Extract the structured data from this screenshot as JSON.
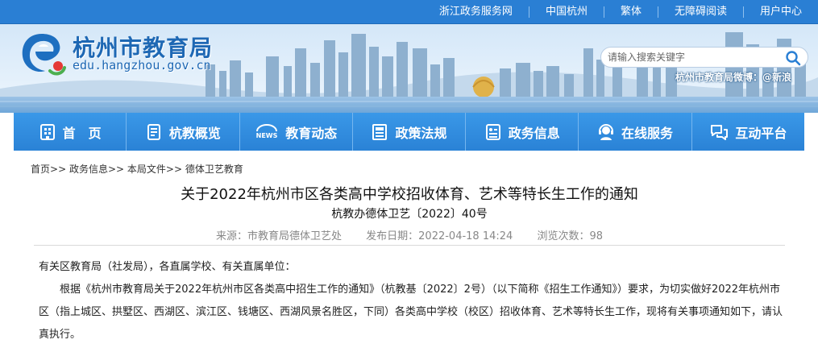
{
  "top_links": [
    "浙江政务服务网",
    "中国杭州",
    "繁体",
    "无障碍阅读",
    "用户中心"
  ],
  "site": {
    "title": "杭州市教育局",
    "domain": "edu.hangzhou.gov.cn"
  },
  "search": {
    "placeholder": "请输入搜索关键字"
  },
  "weibo": "杭州市教育局微博：@新浪",
  "nav": [
    {
      "label": "首　页",
      "icon": "home-icon"
    },
    {
      "label": "杭教概览",
      "icon": "overview-icon"
    },
    {
      "label": "教育动态",
      "icon": "news-icon"
    },
    {
      "label": "政策法规",
      "icon": "policy-icon"
    },
    {
      "label": "政务信息",
      "icon": "info-icon"
    },
    {
      "label": "在线服务",
      "icon": "service-icon"
    },
    {
      "label": "互动平台",
      "icon": "chat-icon"
    }
  ],
  "breadcrumb": [
    "首页",
    "政务信息",
    "本局文件",
    "德体卫艺教育"
  ],
  "breadcrumb_sep": ">> ",
  "article": {
    "title": "关于2022年杭州市区各类高中学校招收体育、艺术等特长生工作的通知",
    "doc_no": "杭教办德体卫艺〔2022〕40号",
    "source": "来源：市教育局德体卫艺处",
    "date": "发布日期：2022-04-18 14:24",
    "views": "浏览次数：98",
    "salutation": "有关区教育局（社发局），各直属学校、有关直属单位：",
    "para1": "根据《杭州市教育局关于2022年杭州市区各类高中招生工作的通知》（杭教基〔2022〕2号）（以下简称《招生工作通知》）要求，为切实做好2022年杭州市区（指上城区、拱墅区、西湖区、滨江区、钱塘区、西湖风景名胜区，下同）各类高中学校（校区）招收体育、艺术等特长生工作，现将有关事项通知如下，请认真执行。"
  },
  "colors": {
    "topbar": "#2a7fd4",
    "nav": "#2a82d6",
    "title_blue": "#1e68b4"
  }
}
